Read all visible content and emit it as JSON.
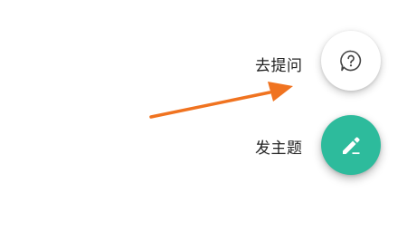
{
  "actions": {
    "ask": {
      "label": "去提问",
      "icon": "question-bubble-icon",
      "bg_color": "#ffffff",
      "icon_color": "#444444"
    },
    "post": {
      "label": "发主题",
      "icon": "pencil-edit-icon",
      "bg_color": "#2dbb9c",
      "icon_color": "#ffffff"
    }
  },
  "annotation": {
    "icon": "arrow-icon",
    "color": "#f07320"
  }
}
